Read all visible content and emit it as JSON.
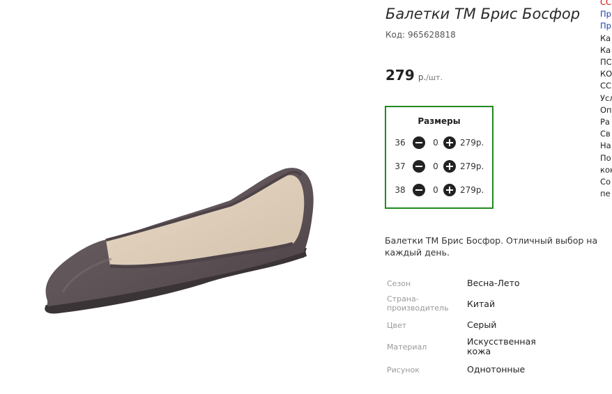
{
  "product": {
    "title": "Балетки ТМ Брис Босфор",
    "code": "Код: 965628818",
    "price": {
      "value": "279",
      "unit": "р.",
      "per": "/шт."
    }
  },
  "sizes": {
    "title": "Размеры",
    "rows": [
      {
        "size": "36",
        "qty": "0",
        "price": "279р."
      },
      {
        "size": "37",
        "qty": "0",
        "price": "279р."
      },
      {
        "size": "38",
        "qty": "0",
        "price": "279р."
      }
    ]
  },
  "description": "Балетки ТМ Брис Босфор. Отличный выбор на каждый день.",
  "specs": [
    {
      "label": "Сезон",
      "value": "Весна-Лето"
    },
    {
      "label": "Страна-\nпроизводитель",
      "value": "Китай"
    },
    {
      "label": "Цвет",
      "value": "Серый"
    },
    {
      "label": "Материал",
      "value": "Искусственная\nкожа"
    },
    {
      "label": "Рисунок",
      "value": "Однотонные"
    }
  ],
  "side_links": [
    {
      "text": "СС",
      "color": "#d40000"
    },
    {
      "text": "Пр",
      "color": "#1a3fa8"
    },
    {
      "text": "Пр",
      "color": "#1a3fa8"
    },
    {
      "text": "Ка",
      "color": "#222222"
    },
    {
      "text": "Ка",
      "color": "#222222"
    },
    {
      "text": "ПС",
      "color": "#222222"
    },
    {
      "text": "КО",
      "color": "#222222"
    },
    {
      "text": "СС",
      "color": "#222222"
    },
    {
      "text": "Усл",
      "color": "#222222"
    },
    {
      "text": "Оп",
      "color": "#222222"
    },
    {
      "text": "Ра",
      "color": "#222222"
    },
    {
      "text": "Св",
      "color": "#222222"
    },
    {
      "text": "На",
      "color": "#222222"
    },
    {
      "text": "По",
      "color": "#222222"
    },
    {
      "text": "кон",
      "color": "#222222"
    },
    {
      "text": "Со",
      "color": "#222222"
    },
    {
      "text": "пе",
      "color": "#222222"
    }
  ],
  "colors": {
    "sizes_border": "#1e8a1e",
    "shoe": "#5e5356"
  }
}
